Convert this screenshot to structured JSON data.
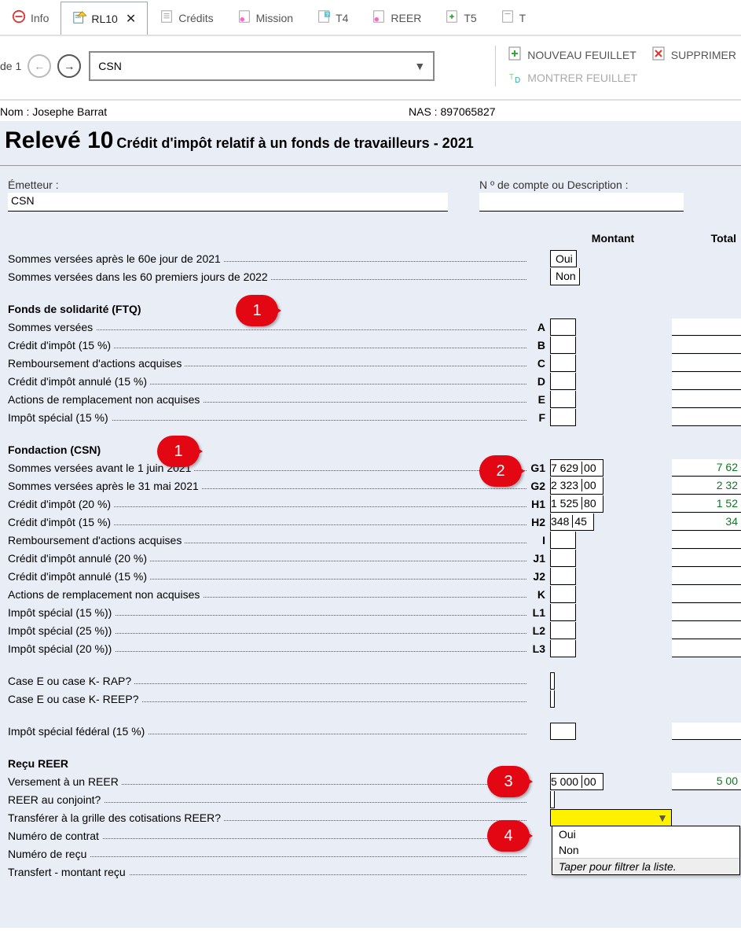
{
  "tabs": [
    {
      "label": "Info",
      "icon": "minus-red"
    },
    {
      "label": "RL10",
      "icon": "form-warn",
      "active": true,
      "closable": true
    },
    {
      "label": "Crédits",
      "icon": "form"
    },
    {
      "label": "Mission",
      "icon": "form-pink"
    },
    {
      "label": "T4",
      "icon": "form-q"
    },
    {
      "label": "REER",
      "icon": "form-pink"
    },
    {
      "label": "T5",
      "icon": "form-plus"
    },
    {
      "label": "T",
      "icon": "form"
    }
  ],
  "pager": {
    "label": "de 1"
  },
  "issuer_select": "CSN",
  "action_buttons": {
    "new": "NOUVEAU FEUILLET",
    "delete": "SUPPRIMER",
    "show": "MONTRER FEUILLET"
  },
  "client": {
    "name_label": "Nom :",
    "name": "Josephe Barrat",
    "nas_label": "NAS :",
    "nas": "897065827"
  },
  "title_main": "Relevé 10",
  "title_sub": "Crédit d'impôt relatif à un fonds de travailleurs - 2021",
  "header_fields": {
    "emetteur_label": "Émetteur :",
    "emetteur_value": "CSN",
    "compte_label": "N º de compte ou Description :",
    "compte_value": ""
  },
  "col_headers": {
    "montant": "Montant",
    "total": "Total"
  },
  "dropdown": {
    "options": [
      "Oui",
      "Non"
    ],
    "hint": "Taper pour filtrer la liste."
  },
  "callouts": {
    "c1": "1",
    "c2": "2",
    "c3": "3",
    "c4": "4"
  },
  "lines": {
    "after60_2021": {
      "label": "Sommes versées après le 60e jour de 2021",
      "montant_text": "Oui"
    },
    "first60_2022": {
      "label": "Sommes versées dans les 60 premiers jours de 2022",
      "montant_text": "Non"
    },
    "ftq_header": {
      "label": "Fonds de solidarité (FTQ)"
    },
    "ftq_sommes": {
      "label": "Sommes versées",
      "box": "A"
    },
    "ftq_credit15": {
      "label": "Crédit d'impôt (15 %)",
      "box": "B"
    },
    "ftq_remb": {
      "label": "Remboursement d'actions acquises",
      "box": "C"
    },
    "ftq_annule15": {
      "label": "Crédit d'impôt annulé (15 %)",
      "box": "D"
    },
    "ftq_remplace": {
      "label": "Actions de remplacement non acquises",
      "box": "E"
    },
    "ftq_special15": {
      "label": "Impôt spécial (15 %)",
      "box": "F"
    },
    "csn_header": {
      "label": "Fondaction (CSN)"
    },
    "csn_avant": {
      "label": "Sommes versées avant le 1   juin 2021",
      "box": "G1",
      "whole": "7 629",
      "cents": "00",
      "total": "7 62"
    },
    "csn_apres": {
      "label": "Sommes versées après le 31 mai 2021",
      "box": "G2",
      "whole": "2 323",
      "cents": "00",
      "total": "2 32"
    },
    "csn_credit20": {
      "label": "Crédit d'impôt (20 %)",
      "box": "H1",
      "whole": "1 525",
      "cents": "80",
      "total": "1 52"
    },
    "csn_credit15": {
      "label": "Crédit d'impôt (15 %)",
      "box": "H2",
      "whole": "348",
      "cents": "45",
      "total": "34"
    },
    "csn_remb": {
      "label": "Remboursement d'actions acquises",
      "box": "I"
    },
    "csn_annule20": {
      "label": "Crédit d'impôt annulé (20 %)",
      "box": "J1"
    },
    "csn_annule15": {
      "label": "Crédit d'impôt annulé (15 %)",
      "box": "J2"
    },
    "csn_remplace": {
      "label": "Actions de remplacement non acquises",
      "box": "K"
    },
    "csn_sp15": {
      "label": "Impôt spécial (15 %))",
      "box": "L1"
    },
    "csn_sp25": {
      "label": "Impôt spécial (25 %))",
      "box": "L2"
    },
    "csn_sp20": {
      "label": "Impôt spécial (20 %))",
      "box": "L3"
    },
    "case_rap": {
      "label": "Case E ou case K- RAP?"
    },
    "case_reep": {
      "label": "Case E ou case K- REEP?"
    },
    "impot_federal": {
      "label": "Impôt spécial fédéral (15 %)"
    },
    "reer_header": {
      "label": "Reçu REER"
    },
    "reer_versement": {
      "label": "Versement à un REER",
      "whole": "5 000",
      "cents": "00",
      "total": "5 00"
    },
    "reer_conjoint": {
      "label": "REER au conjoint?"
    },
    "reer_transfer": {
      "label": "Transférer à la grille des cotisations REER?"
    },
    "reer_contrat": {
      "label": "Numéro de contrat"
    },
    "reer_recu": {
      "label": "Numéro de reçu"
    },
    "reer_montant": {
      "label": "Transfert - montant reçu"
    }
  }
}
